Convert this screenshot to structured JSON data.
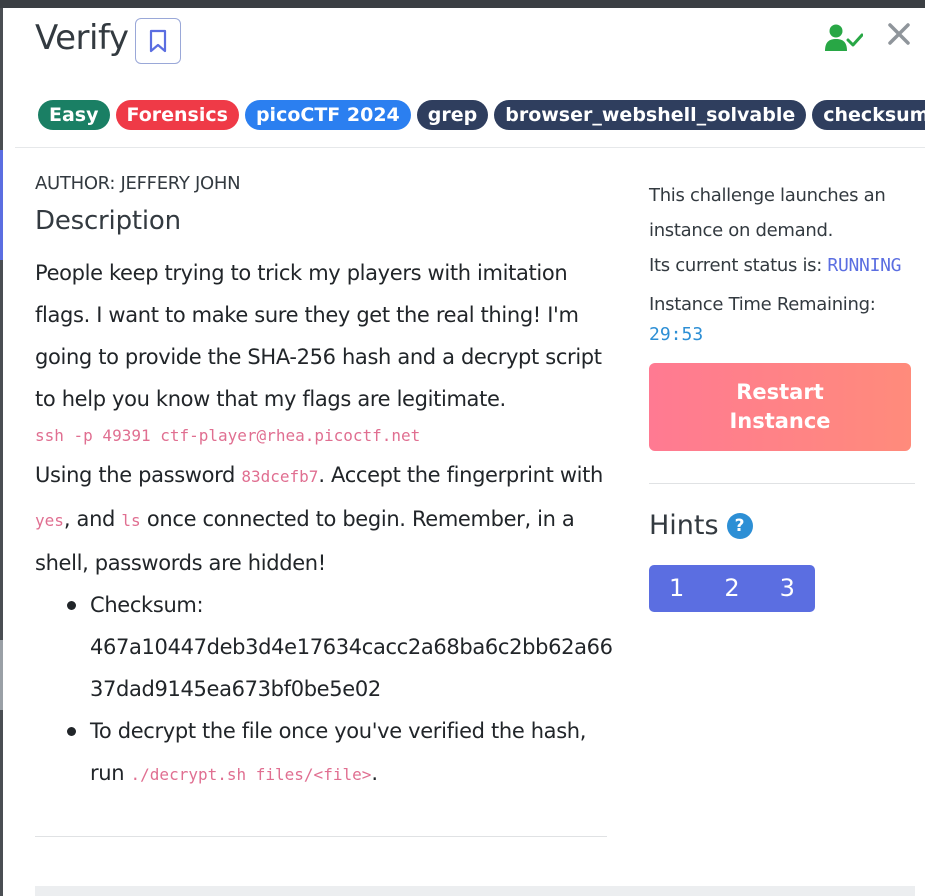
{
  "header": {
    "title": "Verify"
  },
  "tags": [
    {
      "label": "Easy",
      "color": "#1a7f64"
    },
    {
      "label": "Forensics",
      "color": "#ef3a47"
    },
    {
      "label": "picoCTF 2024",
      "color": "#2b7ff0"
    },
    {
      "label": "grep",
      "color": "#2f3e5e"
    },
    {
      "label": "browser_webshell_solvable",
      "color": "#2f3e5e"
    },
    {
      "label": "checksum",
      "color": "#2f3e5e"
    }
  ],
  "author": "AUTHOR: JEFFERY JOHN",
  "description": {
    "heading": "Description",
    "para1": "People keep trying to trick my players with imitation flags. I want to make sure they get the real thing! I'm going to provide the SHA-256 hash and a decrypt script to help you know that my flags are legitimate.",
    "ssh_command": "ssh -p 49391 ctf-player@rhea.picoctf.net",
    "pw_prefix": "Using the password ",
    "password": "83dcefb7",
    "pw_mid": ". Accept the fingerprint with ",
    "yes_code": "yes",
    "pw_and": ", and ",
    "ls_code": "ls",
    "pw_suffix": " once connected to begin. Remember, in a shell, passwords are hidden!",
    "bullet1_label": "Checksum:",
    "checksum_line1": "467a10447deb3d4e17634cacc2a68ba6c2bb62a66",
    "checksum_line2": "37dad9145ea673bf0be5e02",
    "bullet2_text": "To decrypt the file once you've verified the hash, run ",
    "decrypt_code": "./decrypt.sh files/<file>",
    "bullet2_end": "."
  },
  "instance": {
    "line1": "This challenge launches an",
    "line2": "instance on demand.",
    "status_label": "Its current status is: ",
    "status_value": "RUNNING",
    "time_label": "Instance Time Remaining:",
    "time_value": "29:53",
    "restart_line1": "Restart",
    "restart_line2": "Instance"
  },
  "hints": {
    "title": "Hints",
    "help_icon": "?",
    "buttons": [
      "1",
      "2",
      "3"
    ]
  },
  "icons": {
    "bookmark": "bookmark-icon",
    "user_check": "user-check-icon",
    "close": "close-icon"
  }
}
